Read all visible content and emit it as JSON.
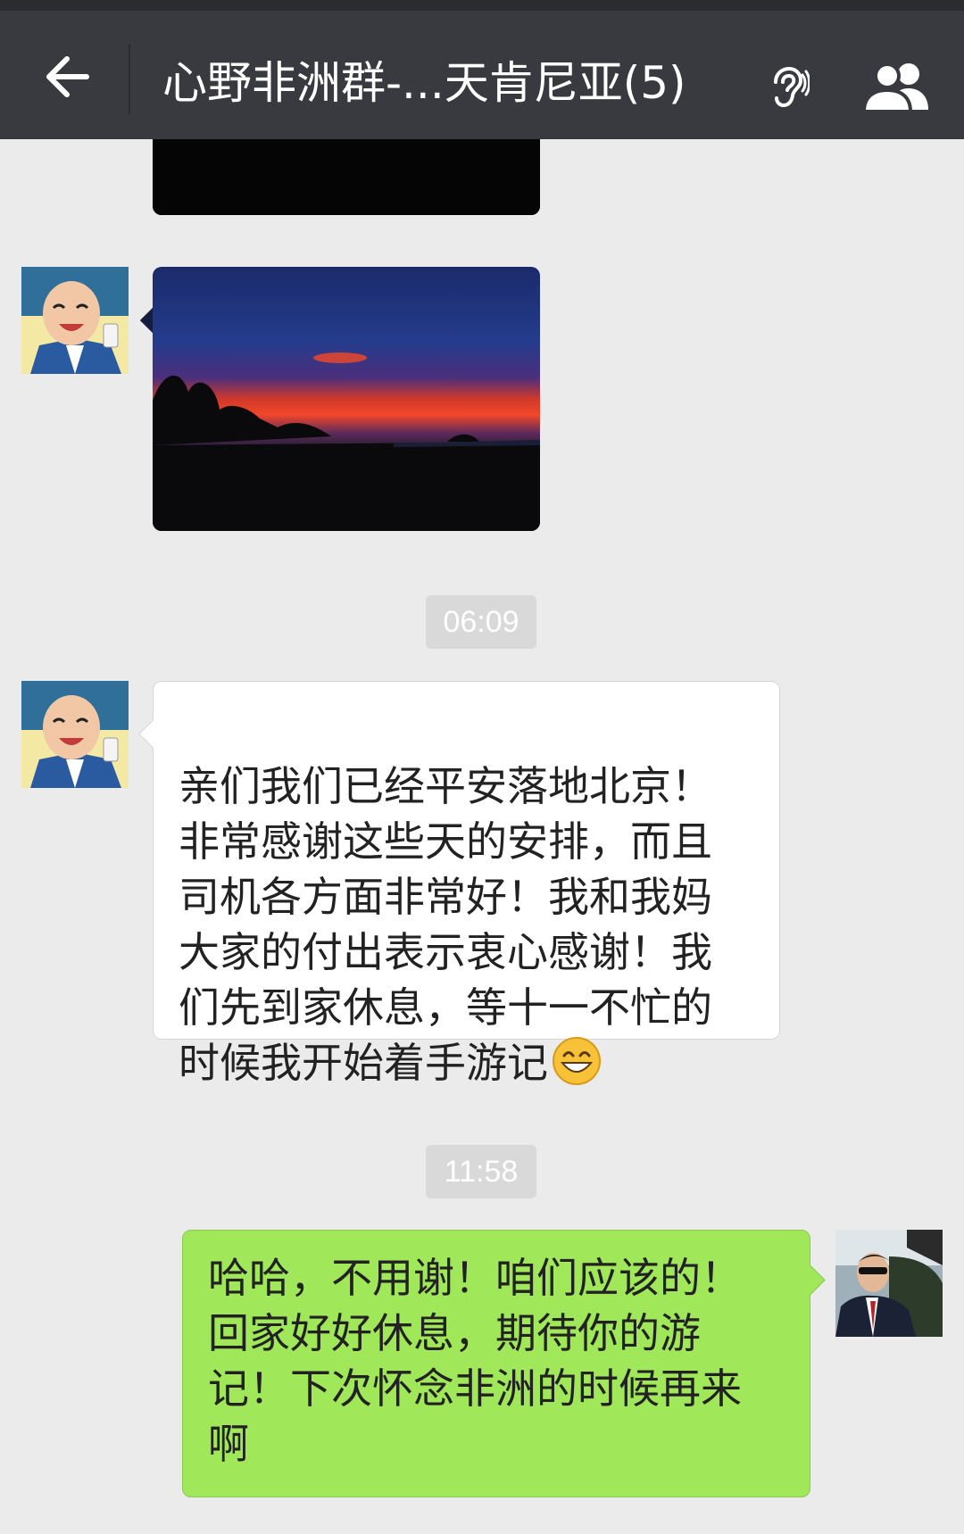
{
  "header": {
    "title": "心野非洲群-...天肯尼亚(5)",
    "back_icon": "arrow-left-icon",
    "earpiece_icon": "ear-icon",
    "members_icon": "group-members-icon",
    "background_color": "#393a3f"
  },
  "messages": [
    {
      "type": "image",
      "direction": "incoming",
      "description_icon": "image"
    },
    {
      "type": "image",
      "direction": "incoming",
      "description_icon": "image"
    },
    {
      "type": "timestamp",
      "text": "06:09"
    },
    {
      "type": "text",
      "direction": "incoming",
      "text_main": "亲们我们已经平安落地北京！\n非常感谢这些天的安排，而且\n司机各方面非常好！我和我妈\n大家的付出表示衷心感谢！我\n们先到家休息，等十一不忙的\n时候我开始着手游记",
      "emoji": "grinning-face-icon"
    },
    {
      "type": "timestamp",
      "text": "11:58"
    },
    {
      "type": "text",
      "direction": "outgoing",
      "text": "哈哈，不用谢！咱们应该的！\n回家好好休息，期待你的游\n记！下次怀念非洲的时候再来\n啊"
    }
  ],
  "colors": {
    "chat_background": "#ebebeb",
    "outgoing_bubble": "#a0e75a",
    "incoming_bubble": "#ffffff",
    "timestamp_background": "#d9d9d9"
  }
}
